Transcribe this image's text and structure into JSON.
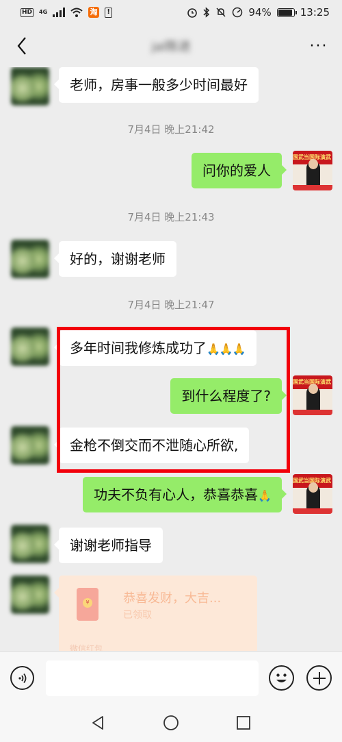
{
  "status_bar": {
    "hd": "HD",
    "network": "4G",
    "app_badge": "淘",
    "alert": "!",
    "battery": "94%",
    "battery_level": 0.94,
    "time": "13:25"
  },
  "header": {
    "title": "jal陈进",
    "more": "···"
  },
  "messages": [
    {
      "side": "in",
      "text": "老师，房事一般多少时间最好"
    },
    {
      "time": "7月4日 晚上21:42"
    },
    {
      "side": "out",
      "text": "问你的爱人"
    },
    {
      "time": "7月4日 晚上21:43"
    },
    {
      "side": "in",
      "text": "好的，谢谢老师"
    },
    {
      "time": "7月4日 晚上21:47"
    },
    {
      "side": "in",
      "text": "多年时间我修炼成功了",
      "emoji": "🙏🙏🙏"
    },
    {
      "side": "out",
      "text": "到什么程度了?"
    },
    {
      "side": "in",
      "text": "金枪不倒交而不泄随心所欲,"
    },
    {
      "side": "out",
      "text": "功夫不负有心人，恭喜恭喜",
      "emoji": "🙏"
    },
    {
      "side": "in",
      "text": "谢谢老师指导"
    }
  ],
  "red_packet": {
    "title": "恭喜发财，大吉...",
    "status": "已领取",
    "label": "微信红包"
  },
  "avatar_banner": "国武当国际演武",
  "input": {
    "value": ""
  },
  "colors": {
    "outgoing_bubble": "#95ec69",
    "incoming_bubble": "#ffffff",
    "highlight_border": "#f2000b",
    "background": "#ededed"
  }
}
